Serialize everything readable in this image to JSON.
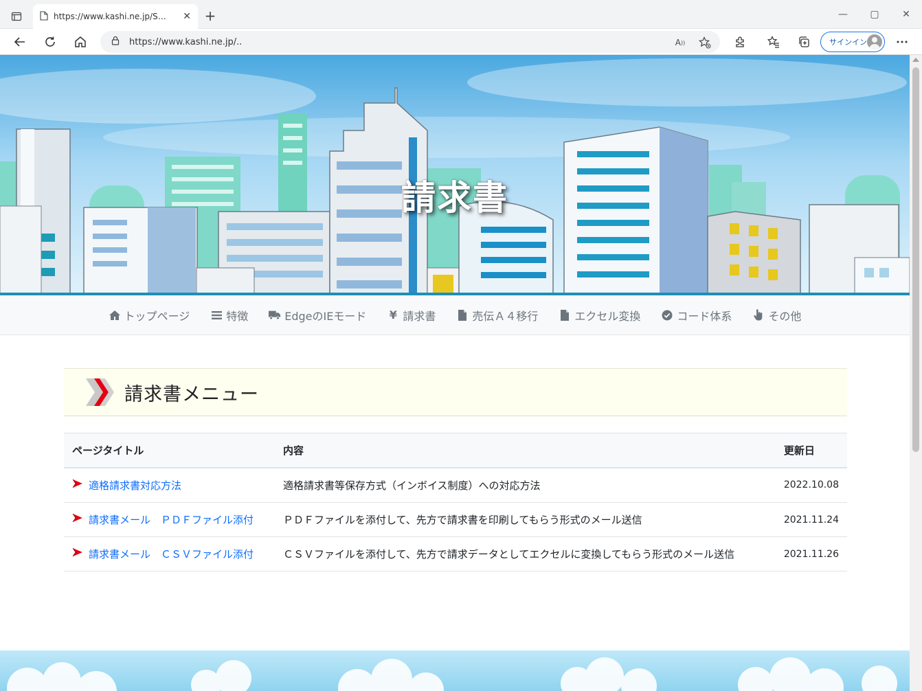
{
  "browser": {
    "tab_title": "https://www.kashi.ne.jp/Support",
    "url": "https://www.kashi.ne.jp/..",
    "signin_label": "サインイン"
  },
  "hero": {
    "title": "請求書"
  },
  "nav": {
    "items": [
      {
        "label": "トップページ",
        "icon": "home-icon"
      },
      {
        "label": "特徴",
        "icon": "list-icon"
      },
      {
        "label": "EdgeのIEモード",
        "icon": "truck-icon"
      },
      {
        "label": "請求書",
        "icon": "yen-icon"
      },
      {
        "label": "売伝Ａ４移行",
        "icon": "document-icon"
      },
      {
        "label": "エクセル変換",
        "icon": "document-icon"
      },
      {
        "label": "コード体系",
        "icon": "check-circle-icon"
      },
      {
        "label": "その他",
        "icon": "hand-pointer-icon"
      }
    ]
  },
  "section": {
    "heading": "請求書メニュー"
  },
  "table": {
    "headers": [
      "ページタイトル",
      "内容",
      "更新日"
    ],
    "rows": [
      {
        "title": "適格請求書対応方法",
        "content": "適格請求書等保存方式（インボイス制度）への対応方法",
        "date": "2022.10.08"
      },
      {
        "title": "請求書メール　ＰＤＦファイル添付",
        "content": "ＰＤＦファイルを添付して、先方で請求書を印刷してもらう形式のメール送信",
        "date": "2021.11.24"
      },
      {
        "title": "請求書メール　ＣＳＶファイル添付",
        "content": "ＣＳＶファイルを添付して、先方で請求データとしてエクセルに変換してもらう形式のメール送信",
        "date": "2021.11.26"
      }
    ]
  },
  "colors": {
    "link": "#0d6efd",
    "nav_text": "#6c757d",
    "heading_bg": "#fffff0",
    "bullet_red": "#e60012"
  }
}
